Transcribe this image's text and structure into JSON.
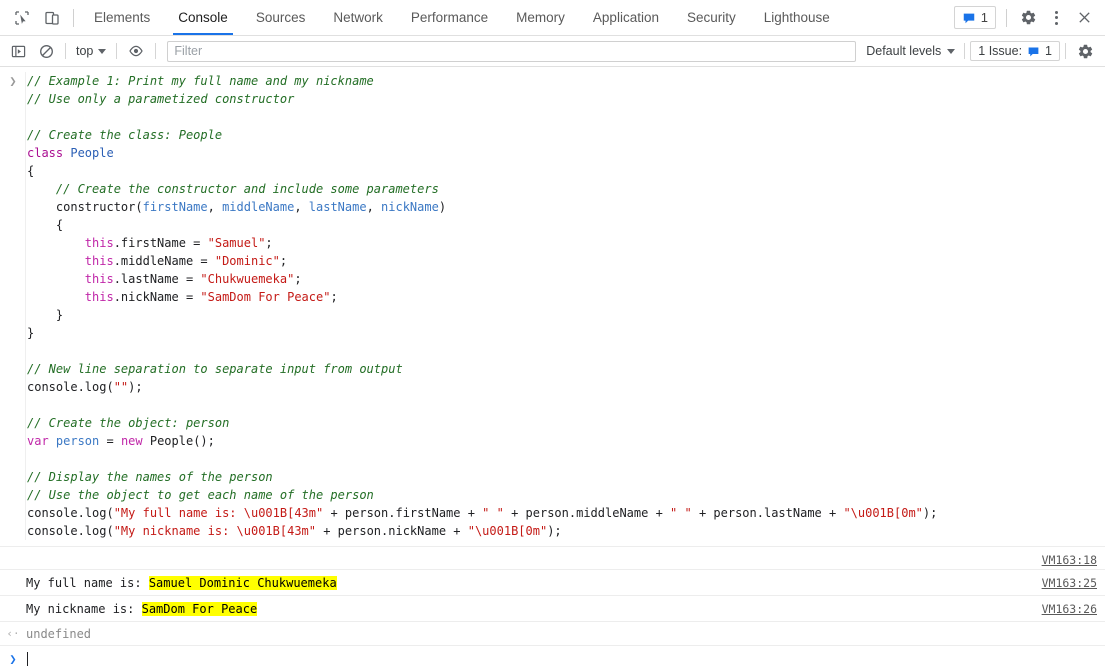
{
  "window": {
    "app": "Chrome DevTools",
    "panel": "Console"
  },
  "tabbar": {
    "inspect_icon": "cursor-select-icon",
    "device_icon": "device-toolbar-icon",
    "tabs": [
      {
        "label": "Elements",
        "active": false
      },
      {
        "label": "Console",
        "active": true
      },
      {
        "label": "Sources",
        "active": false
      },
      {
        "label": "Network",
        "active": false
      },
      {
        "label": "Performance",
        "active": false
      },
      {
        "label": "Memory",
        "active": false
      },
      {
        "label": "Application",
        "active": false
      },
      {
        "label": "Security",
        "active": false
      },
      {
        "label": "Lighthouse",
        "active": false
      }
    ],
    "issues_badge_count": "1",
    "settings_icon": "gear-icon",
    "more_icon": "kebab-menu-icon",
    "close_icon": "close-icon",
    "accent_color": "#1a73e8"
  },
  "filterbar": {
    "sidebar_toggle_icon": "show-console-sidebar-icon",
    "clear_icon": "clear-console-icon",
    "context": "top",
    "eye_icon": "create-live-expression-icon",
    "filter_value": "",
    "filter_placeholder": "Filter",
    "levels_label": "Default levels",
    "issues_label": "1 Issue:",
    "issues_count": "1",
    "settings_icon": "settings-gear-icon"
  },
  "console": {
    "input_prompt_icon": "chevron-right-icon",
    "code_lines": [
      [
        {
          "t": "// Example 1: Print my full name and my nickname",
          "c": "c-comment"
        }
      ],
      [
        {
          "t": "// Use only a parametized constructor",
          "c": "c-comment"
        }
      ],
      [
        {
          "t": "",
          "c": "c-plain"
        }
      ],
      [
        {
          "t": "// Create the class: People",
          "c": "c-comment"
        }
      ],
      [
        {
          "t": "class ",
          "c": "c-kw"
        },
        {
          "t": "People",
          "c": "c-type"
        }
      ],
      [
        {
          "t": "{",
          "c": "c-plain"
        }
      ],
      [
        {
          "t": "    // Create the constructor and include some parameters",
          "c": "c-comment"
        }
      ],
      [
        {
          "t": "    constructor(",
          "c": "c-plain"
        },
        {
          "t": "firstName",
          "c": "c-param"
        },
        {
          "t": ", ",
          "c": "c-plain"
        },
        {
          "t": "middleName",
          "c": "c-param"
        },
        {
          "t": ", ",
          "c": "c-plain"
        },
        {
          "t": "lastName",
          "c": "c-param"
        },
        {
          "t": ", ",
          "c": "c-plain"
        },
        {
          "t": "nickName",
          "c": "c-param"
        },
        {
          "t": ")",
          "c": "c-plain"
        }
      ],
      [
        {
          "t": "    {",
          "c": "c-plain"
        }
      ],
      [
        {
          "t": "        ",
          "c": "c-plain"
        },
        {
          "t": "this",
          "c": "c-kw2"
        },
        {
          "t": ".firstName = ",
          "c": "c-plain"
        },
        {
          "t": "\"Samuel\"",
          "c": "c-str"
        },
        {
          "t": ";",
          "c": "c-plain"
        }
      ],
      [
        {
          "t": "        ",
          "c": "c-plain"
        },
        {
          "t": "this",
          "c": "c-kw2"
        },
        {
          "t": ".middleName = ",
          "c": "c-plain"
        },
        {
          "t": "\"Dominic\"",
          "c": "c-str"
        },
        {
          "t": ";",
          "c": "c-plain"
        }
      ],
      [
        {
          "t": "        ",
          "c": "c-plain"
        },
        {
          "t": "this",
          "c": "c-kw2"
        },
        {
          "t": ".lastName = ",
          "c": "c-plain"
        },
        {
          "t": "\"Chukwuemeka\"",
          "c": "c-str"
        },
        {
          "t": ";",
          "c": "c-plain"
        }
      ],
      [
        {
          "t": "        ",
          "c": "c-plain"
        },
        {
          "t": "this",
          "c": "c-kw2"
        },
        {
          "t": ".nickName = ",
          "c": "c-plain"
        },
        {
          "t": "\"SamDom For Peace\"",
          "c": "c-str"
        },
        {
          "t": ";",
          "c": "c-plain"
        }
      ],
      [
        {
          "t": "    }",
          "c": "c-plain"
        }
      ],
      [
        {
          "t": "}",
          "c": "c-plain"
        }
      ],
      [
        {
          "t": "",
          "c": "c-plain"
        }
      ],
      [
        {
          "t": "// New line separation to separate input from output",
          "c": "c-comment"
        }
      ],
      [
        {
          "t": "console.log(",
          "c": "c-plain"
        },
        {
          "t": "\"\"",
          "c": "c-str"
        },
        {
          "t": ");",
          "c": "c-plain"
        }
      ],
      [
        {
          "t": "",
          "c": "c-plain"
        }
      ],
      [
        {
          "t": "// Create the object: person",
          "c": "c-comment"
        }
      ],
      [
        {
          "t": "var ",
          "c": "c-kw2"
        },
        {
          "t": "person",
          "c": "c-param"
        },
        {
          "t": " = ",
          "c": "c-plain"
        },
        {
          "t": "new ",
          "c": "c-kw2"
        },
        {
          "t": "People();",
          "c": "c-plain"
        }
      ],
      [
        {
          "t": "",
          "c": "c-plain"
        }
      ],
      [
        {
          "t": "// Display the names of the person",
          "c": "c-comment"
        }
      ],
      [
        {
          "t": "// Use the object to get each name of the person",
          "c": "c-comment"
        }
      ],
      [
        {
          "t": "console.log(",
          "c": "c-plain"
        },
        {
          "t": "\"My full name is: \\u001B[43m\"",
          "c": "c-str"
        },
        {
          "t": " + person.firstName + ",
          "c": "c-plain"
        },
        {
          "t": "\" \"",
          "c": "c-str"
        },
        {
          "t": " + person.middleName + ",
          "c": "c-plain"
        },
        {
          "t": "\" \"",
          "c": "c-str"
        },
        {
          "t": " + person.lastName + ",
          "c": "c-plain"
        },
        {
          "t": "\"\\u001B[0m\"",
          "c": "c-str"
        },
        {
          "t": ");",
          "c": "c-plain"
        }
      ],
      [
        {
          "t": "console.log(",
          "c": "c-plain"
        },
        {
          "t": "\"My nickname is: \\u001B[43m\"",
          "c": "c-str"
        },
        {
          "t": " + person.nickName + ",
          "c": "c-plain"
        },
        {
          "t": "\"\\u001B[0m\"",
          "c": "c-str"
        },
        {
          "t": ");",
          "c": "c-plain"
        }
      ]
    ],
    "output_rows": [
      {
        "prefix": "",
        "highlight": "",
        "suffix": "",
        "link": "VM163:18",
        "blank": true
      },
      {
        "prefix": "My full name is: ",
        "highlight": "Samuel Dominic Chukwuemeka",
        "suffix": "",
        "link": "VM163:25",
        "blank": false
      },
      {
        "prefix": "My nickname is: ",
        "highlight": "SamDom For Peace",
        "suffix": "",
        "link": "VM163:26",
        "blank": false
      }
    ],
    "return_arrow": "‹·",
    "return_value": "undefined",
    "prompt_chevron": "❯",
    "highlight_color": "#ffff00"
  }
}
